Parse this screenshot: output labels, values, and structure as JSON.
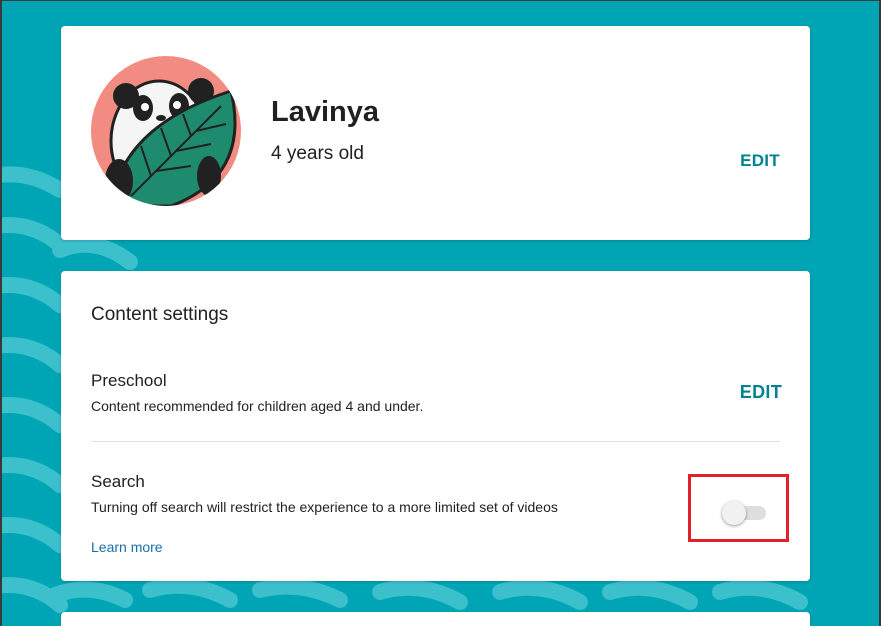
{
  "profile": {
    "name": "Lavinya",
    "age": "4 years old",
    "edit_label": "EDIT",
    "avatar_icon": "panda-avatar-icon"
  },
  "content_settings": {
    "title": "Content settings",
    "preschool": {
      "title": "Preschool",
      "description": "Content recommended for children aged 4 and under.",
      "edit_label": "EDIT"
    },
    "search": {
      "title": "Search",
      "description": "Turning off search will restrict the experience to a more limited set of videos",
      "learn_more": "Learn more",
      "enabled": false
    }
  },
  "colors": {
    "background": "#00a5b5",
    "accent": "#00838f",
    "link": "#1a6fa8",
    "highlight": "#e0202a"
  }
}
